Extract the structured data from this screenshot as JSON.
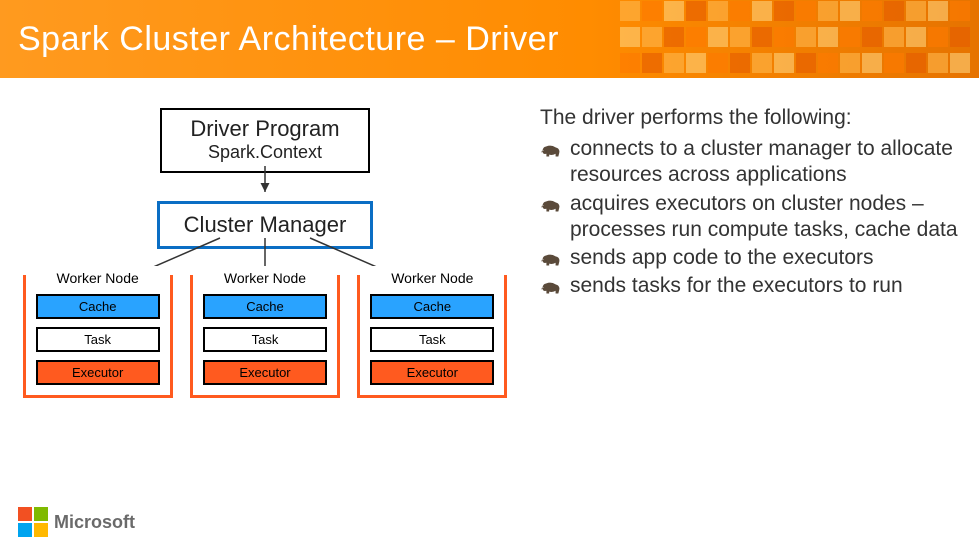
{
  "header": {
    "title": "Spark Cluster Architecture – Driver"
  },
  "diagram": {
    "driver": {
      "title": "Driver Program",
      "sub": "Spark.Context"
    },
    "cluster": {
      "label": "Cluster Manager"
    },
    "worker_label": "Worker Node",
    "cache": "Cache",
    "task": "Task",
    "executor": "Executor"
  },
  "text": {
    "intro": "The driver performs the following:",
    "bullets": [
      "connects to a cluster manager to allocate resources across applications",
      "acquires executors on cluster nodes – processes run compute tasks, cache data",
      "sends app code to the executors",
      "sends tasks for the executors to run"
    ]
  },
  "footer": {
    "brand": "Microsoft"
  }
}
